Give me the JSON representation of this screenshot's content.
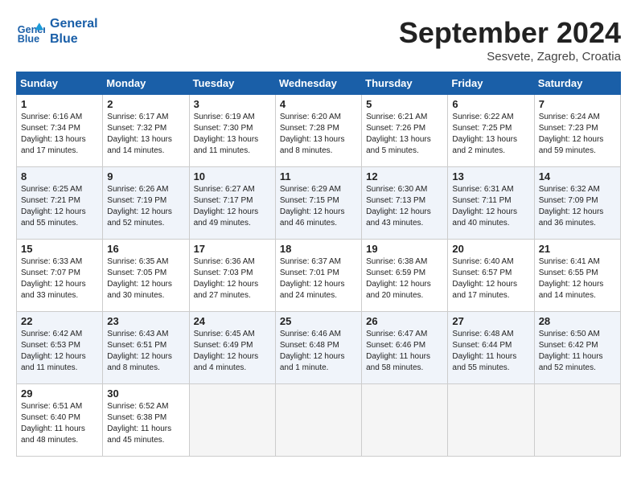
{
  "header": {
    "logo_line1": "General",
    "logo_line2": "Blue",
    "title": "September 2024",
    "location": "Sesvete, Zagreb, Croatia"
  },
  "columns": [
    "Sunday",
    "Monday",
    "Tuesday",
    "Wednesday",
    "Thursday",
    "Friday",
    "Saturday"
  ],
  "weeks": [
    [
      {
        "day": "1",
        "sunrise": "Sunrise: 6:16 AM",
        "sunset": "Sunset: 7:34 PM",
        "daylight": "Daylight: 13 hours and 17 minutes."
      },
      {
        "day": "2",
        "sunrise": "Sunrise: 6:17 AM",
        "sunset": "Sunset: 7:32 PM",
        "daylight": "Daylight: 13 hours and 14 minutes."
      },
      {
        "day": "3",
        "sunrise": "Sunrise: 6:19 AM",
        "sunset": "Sunset: 7:30 PM",
        "daylight": "Daylight: 13 hours and 11 minutes."
      },
      {
        "day": "4",
        "sunrise": "Sunrise: 6:20 AM",
        "sunset": "Sunset: 7:28 PM",
        "daylight": "Daylight: 13 hours and 8 minutes."
      },
      {
        "day": "5",
        "sunrise": "Sunrise: 6:21 AM",
        "sunset": "Sunset: 7:26 PM",
        "daylight": "Daylight: 13 hours and 5 minutes."
      },
      {
        "day": "6",
        "sunrise": "Sunrise: 6:22 AM",
        "sunset": "Sunset: 7:25 PM",
        "daylight": "Daylight: 13 hours and 2 minutes."
      },
      {
        "day": "7",
        "sunrise": "Sunrise: 6:24 AM",
        "sunset": "Sunset: 7:23 PM",
        "daylight": "Daylight: 12 hours and 59 minutes."
      }
    ],
    [
      {
        "day": "8",
        "sunrise": "Sunrise: 6:25 AM",
        "sunset": "Sunset: 7:21 PM",
        "daylight": "Daylight: 12 hours and 55 minutes."
      },
      {
        "day": "9",
        "sunrise": "Sunrise: 6:26 AM",
        "sunset": "Sunset: 7:19 PM",
        "daylight": "Daylight: 12 hours and 52 minutes."
      },
      {
        "day": "10",
        "sunrise": "Sunrise: 6:27 AM",
        "sunset": "Sunset: 7:17 PM",
        "daylight": "Daylight: 12 hours and 49 minutes."
      },
      {
        "day": "11",
        "sunrise": "Sunrise: 6:29 AM",
        "sunset": "Sunset: 7:15 PM",
        "daylight": "Daylight: 12 hours and 46 minutes."
      },
      {
        "day": "12",
        "sunrise": "Sunrise: 6:30 AM",
        "sunset": "Sunset: 7:13 PM",
        "daylight": "Daylight: 12 hours and 43 minutes."
      },
      {
        "day": "13",
        "sunrise": "Sunrise: 6:31 AM",
        "sunset": "Sunset: 7:11 PM",
        "daylight": "Daylight: 12 hours and 40 minutes."
      },
      {
        "day": "14",
        "sunrise": "Sunrise: 6:32 AM",
        "sunset": "Sunset: 7:09 PM",
        "daylight": "Daylight: 12 hours and 36 minutes."
      }
    ],
    [
      {
        "day": "15",
        "sunrise": "Sunrise: 6:33 AM",
        "sunset": "Sunset: 7:07 PM",
        "daylight": "Daylight: 12 hours and 33 minutes."
      },
      {
        "day": "16",
        "sunrise": "Sunrise: 6:35 AM",
        "sunset": "Sunset: 7:05 PM",
        "daylight": "Daylight: 12 hours and 30 minutes."
      },
      {
        "day": "17",
        "sunrise": "Sunrise: 6:36 AM",
        "sunset": "Sunset: 7:03 PM",
        "daylight": "Daylight: 12 hours and 27 minutes."
      },
      {
        "day": "18",
        "sunrise": "Sunrise: 6:37 AM",
        "sunset": "Sunset: 7:01 PM",
        "daylight": "Daylight: 12 hours and 24 minutes."
      },
      {
        "day": "19",
        "sunrise": "Sunrise: 6:38 AM",
        "sunset": "Sunset: 6:59 PM",
        "daylight": "Daylight: 12 hours and 20 minutes."
      },
      {
        "day": "20",
        "sunrise": "Sunrise: 6:40 AM",
        "sunset": "Sunset: 6:57 PM",
        "daylight": "Daylight: 12 hours and 17 minutes."
      },
      {
        "day": "21",
        "sunrise": "Sunrise: 6:41 AM",
        "sunset": "Sunset: 6:55 PM",
        "daylight": "Daylight: 12 hours and 14 minutes."
      }
    ],
    [
      {
        "day": "22",
        "sunrise": "Sunrise: 6:42 AM",
        "sunset": "Sunset: 6:53 PM",
        "daylight": "Daylight: 12 hours and 11 minutes."
      },
      {
        "day": "23",
        "sunrise": "Sunrise: 6:43 AM",
        "sunset": "Sunset: 6:51 PM",
        "daylight": "Daylight: 12 hours and 8 minutes."
      },
      {
        "day": "24",
        "sunrise": "Sunrise: 6:45 AM",
        "sunset": "Sunset: 6:49 PM",
        "daylight": "Daylight: 12 hours and 4 minutes."
      },
      {
        "day": "25",
        "sunrise": "Sunrise: 6:46 AM",
        "sunset": "Sunset: 6:48 PM",
        "daylight": "Daylight: 12 hours and 1 minute."
      },
      {
        "day": "26",
        "sunrise": "Sunrise: 6:47 AM",
        "sunset": "Sunset: 6:46 PM",
        "daylight": "Daylight: 11 hours and 58 minutes."
      },
      {
        "day": "27",
        "sunrise": "Sunrise: 6:48 AM",
        "sunset": "Sunset: 6:44 PM",
        "daylight": "Daylight: 11 hours and 55 minutes."
      },
      {
        "day": "28",
        "sunrise": "Sunrise: 6:50 AM",
        "sunset": "Sunset: 6:42 PM",
        "daylight": "Daylight: 11 hours and 52 minutes."
      }
    ],
    [
      {
        "day": "29",
        "sunrise": "Sunrise: 6:51 AM",
        "sunset": "Sunset: 6:40 PM",
        "daylight": "Daylight: 11 hours and 48 minutes."
      },
      {
        "day": "30",
        "sunrise": "Sunrise: 6:52 AM",
        "sunset": "Sunset: 6:38 PM",
        "daylight": "Daylight: 11 hours and 45 minutes."
      },
      {
        "day": "",
        "sunrise": "",
        "sunset": "",
        "daylight": ""
      },
      {
        "day": "",
        "sunrise": "",
        "sunset": "",
        "daylight": ""
      },
      {
        "day": "",
        "sunrise": "",
        "sunset": "",
        "daylight": ""
      },
      {
        "day": "",
        "sunrise": "",
        "sunset": "",
        "daylight": ""
      },
      {
        "day": "",
        "sunrise": "",
        "sunset": "",
        "daylight": ""
      }
    ]
  ]
}
